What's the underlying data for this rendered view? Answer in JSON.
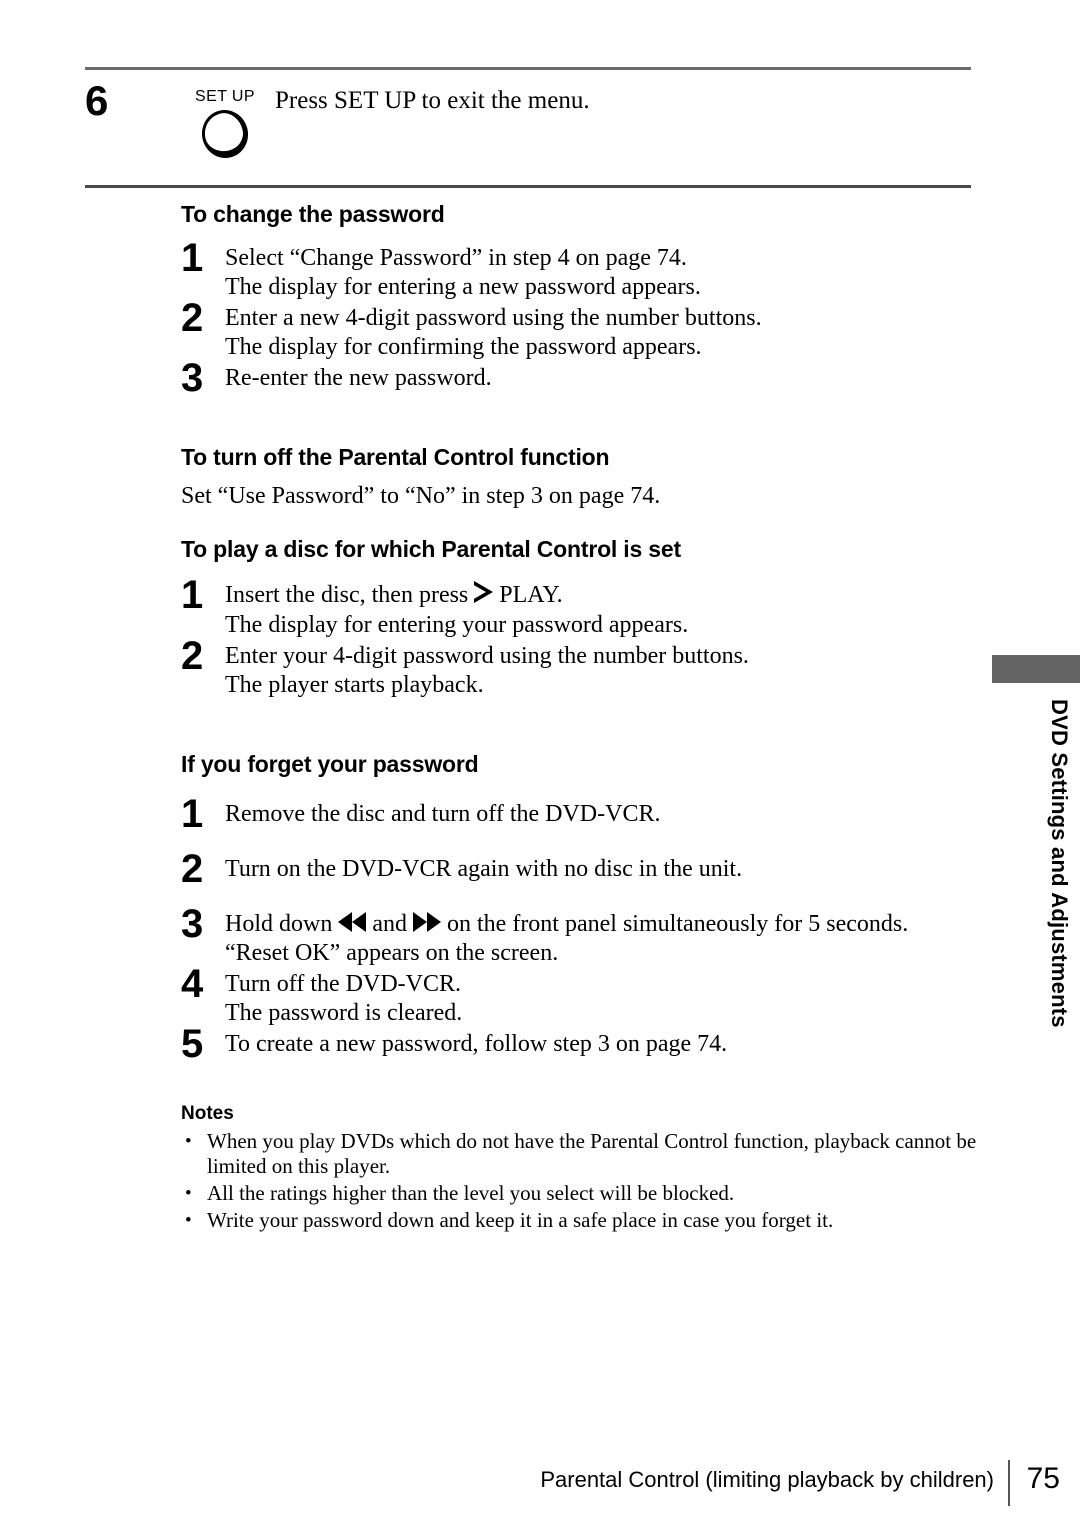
{
  "page": {
    "number": "75",
    "footer_title": "Parental Control (limiting playback by children)",
    "side_tab_text": "DVD Settings and Adjustments",
    "side_tab_color": "#646464"
  },
  "step6": {
    "number": "6",
    "button_label": "SET UP",
    "instruction": "Press SET UP to exit the menu."
  },
  "sections": {
    "change_password": {
      "heading": "To change the password",
      "steps": [
        {
          "num": "1",
          "line1": "Select “Change Password” in step 4 on page 74.",
          "line2": "The display for entering a new password appears."
        },
        {
          "num": "2",
          "line1": "Enter a new 4-digit password using the number buttons.",
          "line2": "The display for confirming the password appears."
        },
        {
          "num": "3",
          "line1": "Re-enter the new password.",
          "line2": ""
        }
      ]
    },
    "turn_off": {
      "heading": "To turn off the Parental Control function",
      "paragraph": "Set “Use Password” to “No” in step 3 on page 74."
    },
    "play_disc": {
      "heading": "To play a disc for which Parental Control is set",
      "steps": [
        {
          "num": "1",
          "line1_before": "Insert the disc, then press",
          "line1_icon": "play-triangle-outline-icon",
          "line1_after": "PLAY.",
          "line2": "The display for entering your password appears."
        },
        {
          "num": "2",
          "line1": "Enter your 4-digit password using the number buttons.",
          "line2": "The player starts playback."
        }
      ]
    },
    "forgot_password": {
      "heading": "If you forget your password",
      "steps": [
        {
          "num": "1",
          "line1": "Remove the disc and turn off the DVD-VCR.",
          "line2": ""
        },
        {
          "num": "2",
          "line1": "Turn on the DVD-VCR again with no disc in the unit.",
          "line2": ""
        },
        {
          "num": "3",
          "line1_before": "Hold down",
          "line1_icon1": "rewind-icon",
          "line1_mid": "and",
          "line1_icon2": "fast-forward-icon",
          "line1_after": "on the front panel simultaneously for 5 seconds.",
          "line2": "“Reset OK” appears on the screen."
        },
        {
          "num": "4",
          "line1": "Turn off the DVD-VCR.",
          "line2": "The password is cleared."
        },
        {
          "num": "5",
          "line1": "To create a new password, follow step 3 on page 74.",
          "line2": ""
        }
      ]
    }
  },
  "notes": {
    "title": "Notes",
    "items": [
      "When you play DVDs which do not have the Parental Control function, playback cannot be limited on this player.",
      "All the ratings higher than the level you select will be blocked.",
      "Write your password down and keep it in a safe place in case you forget it."
    ]
  }
}
